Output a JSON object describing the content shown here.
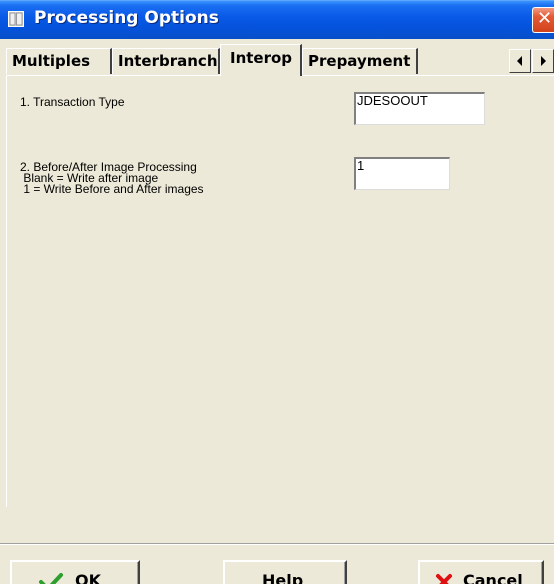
{
  "window": {
    "title": "Processing Options",
    "close_glyph": "✕"
  },
  "tabs": [
    {
      "label": "Multiples",
      "active": false
    },
    {
      "label": "Interbranch",
      "active": false
    },
    {
      "label": "Interop",
      "active": true
    },
    {
      "label": "Prepayment",
      "active": false
    }
  ],
  "options": [
    {
      "label": "1. Transaction Type",
      "value": "JDESOOUT"
    },
    {
      "label": "2. Before/After Image Processing\n Blank = Write after image\n 1 = Write Before and After images",
      "value": "1"
    }
  ],
  "buttons": {
    "ok": {
      "mnemonic": "O",
      "rest": "K",
      "icon": "check-icon"
    },
    "help": {
      "mnemonic": "H",
      "rest": "elp"
    },
    "cancel": {
      "mnemonic": "C",
      "rest": "ancel",
      "icon": "x-icon"
    }
  },
  "colors": {
    "title_bar": "#0a5ae8",
    "close_button": "#d2431d",
    "check_icon": "#2e9e2e",
    "cancel_icon": "#e01010",
    "panel_bg": "#ece9d8"
  }
}
